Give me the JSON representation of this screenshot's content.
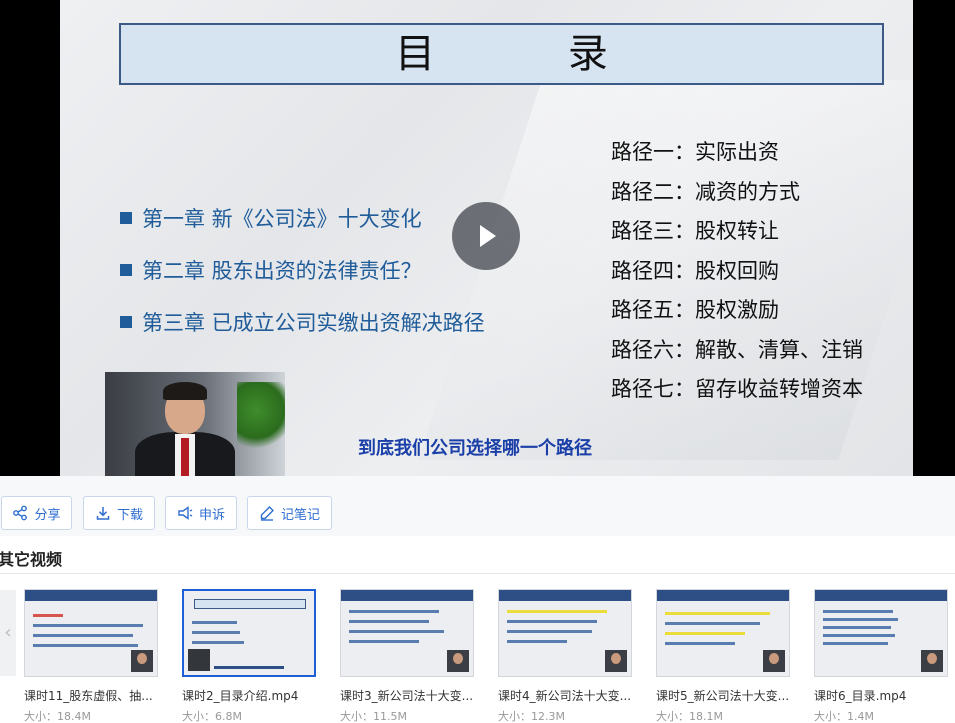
{
  "slide": {
    "title": "目 录",
    "chapters": [
      "第一章  新《公司法》十大变化",
      "第二章  股东出资的法律责任？",
      "第三章  已成立公司实缴出资解决路径"
    ],
    "paths": [
      "路径一：实际出资",
      "路径二：减资的方式",
      "路径三：股权转让",
      "路径四：股权回购",
      "路径五：股权激励",
      "路径六：解散、清算、注销",
      "路径七：留存收益转增资本"
    ],
    "question": "到底我们公司选择哪一个路径"
  },
  "actions": {
    "share": "分享",
    "download": "下载",
    "report": "申诉",
    "notes": "记笔记"
  },
  "other_videos": {
    "heading": "其它视频",
    "items": [
      {
        "title": "课时11_股东虚假、抽...",
        "size": "大小：18.4M",
        "active": false
      },
      {
        "title": "课时2_目录介绍.mp4",
        "size": "大小：6.8M",
        "active": true
      },
      {
        "title": "课时3_新公司法十大变...",
        "size": "大小：11.5M",
        "active": false
      },
      {
        "title": "课时4_新公司法十大变...",
        "size": "大小：12.3M",
        "active": false
      },
      {
        "title": "课时5_新公司法十大变...",
        "size": "大小：18.1M",
        "active": false
      },
      {
        "title": "课时6_目录.mp4",
        "size": "大小：1.4M",
        "active": false
      }
    ]
  },
  "colors": {
    "accent": "#2f6ed1",
    "slide_blue": "#1f5c99",
    "active_border": "#1f5fd6"
  },
  "icons": [
    "play-icon",
    "share-icon",
    "download-icon",
    "megaphone-icon",
    "pen-icon",
    "chevron-left-icon"
  ]
}
